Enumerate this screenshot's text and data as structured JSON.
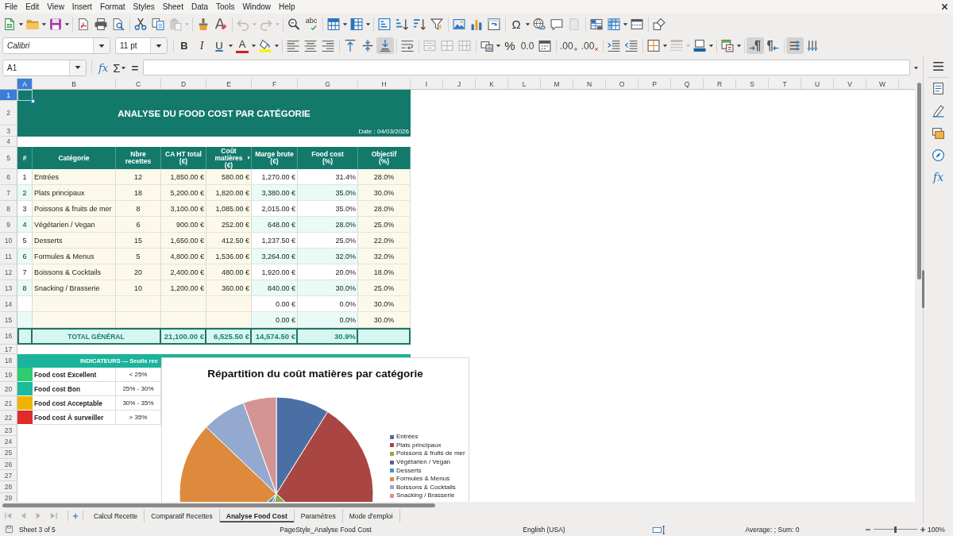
{
  "menu_bar": {
    "items": [
      "File",
      "Edit",
      "View",
      "Insert",
      "Format",
      "Styles",
      "Sheet",
      "Data",
      "Tools",
      "Window",
      "Help"
    ]
  },
  "standard_toolbar": {
    "spelling": "abc",
    "special_character": "Ω",
    "paste_disabled": true,
    "undo_disabled": true,
    "redo_disabled": true,
    "header_footer_disabled": true
  },
  "formatting_toolbar": {
    "font_name": "Calibri",
    "font_size": "11 pt",
    "bold": "B",
    "italic": "I",
    "underline": "U",
    "font_color": "A",
    "percent": "%",
    "standard_format": "0.0",
    "add_decimal": ".00",
    "delete_decimal": ".00",
    "align_bottom_on": true,
    "merge_disabled": true,
    "border_style_disabled": true,
    "left_to_right_on": true,
    "text_left_to_right_on": true
  },
  "formula_bar": {
    "name_box": "A1",
    "function_wizard": "fx",
    "sum": "Σ",
    "equals": "="
  },
  "sheet": {
    "columns": [
      {
        "label": "A",
        "selected": true
      },
      {
        "label": "B",
        "selected": false
      },
      {
        "label": "C",
        "selected": false
      },
      {
        "label": "D",
        "selected": false
      },
      {
        "label": "E",
        "selected": false
      },
      {
        "label": "F",
        "selected": false
      },
      {
        "label": "G",
        "selected": false
      },
      {
        "label": "H",
        "selected": false
      },
      {
        "label": "I",
        "selected": false
      },
      {
        "label": "J",
        "selected": false
      },
      {
        "label": "K",
        "selected": false
      },
      {
        "label": "L",
        "selected": false
      },
      {
        "label": "M",
        "selected": false
      },
      {
        "label": "N",
        "selected": false
      },
      {
        "label": "O",
        "selected": false
      },
      {
        "label": "P",
        "selected": false
      },
      {
        "label": "Q",
        "selected": false
      },
      {
        "label": "R",
        "selected": false
      },
      {
        "label": "S",
        "selected": false
      },
      {
        "label": "T",
        "selected": false
      },
      {
        "label": "U",
        "selected": false
      },
      {
        "label": "V",
        "selected": false
      },
      {
        "label": "W",
        "selected": false
      }
    ],
    "rows": [
      {
        "label": "1",
        "selected": true
      },
      {
        "label": "2",
        "selected": false
      },
      {
        "label": "3",
        "selected": false
      },
      {
        "label": "4",
        "selected": false
      },
      {
        "label": "5",
        "selected": false
      },
      {
        "label": "6",
        "selected": false
      },
      {
        "label": "7",
        "selected": false
      },
      {
        "label": "8",
        "selected": false
      },
      {
        "label": "9",
        "selected": false
      },
      {
        "label": "10",
        "selected": false
      },
      {
        "label": "11",
        "selected": false
      },
      {
        "label": "12",
        "selected": false
      },
      {
        "label": "13",
        "selected": false
      },
      {
        "label": "14",
        "selected": false
      },
      {
        "label": "15",
        "selected": false
      },
      {
        "label": "16",
        "selected": false
      },
      {
        "label": "17",
        "selected": false
      },
      {
        "label": "18",
        "selected": false
      },
      {
        "label": "19",
        "selected": false
      },
      {
        "label": "20",
        "selected": false
      },
      {
        "label": "21",
        "selected": false
      },
      {
        "label": "22",
        "selected": false
      },
      {
        "label": "23",
        "selected": false
      },
      {
        "label": "24",
        "selected": false
      },
      {
        "label": "25",
        "selected": false
      },
      {
        "label": "26",
        "selected": false
      },
      {
        "label": "27",
        "selected": false
      },
      {
        "label": "28",
        "selected": false
      },
      {
        "label": "29",
        "selected": false
      }
    ],
    "title": "ANALYSE DU FOOD COST PAR CATÉGORIE",
    "date": "Date : 04/03/2026",
    "table": {
      "columns": [
        {
          "label": "#"
        },
        {
          "label": "Catégorie"
        },
        {
          "label": "Nbre\nrecettes"
        },
        {
          "label": "CA HT total\n(€)"
        },
        {
          "label": "Coût\nmatières\n(€)",
          "overflow_marker": true
        },
        {
          "label": "Marge brute\n(€)"
        },
        {
          "label": "Food cost\n(%)"
        },
        {
          "label": "Objectif\n(%)"
        }
      ],
      "rows": [
        {
          "num": "1",
          "category": "Entrées",
          "recipes": "12",
          "revenue": "1,850.00 €",
          "cost": "580.00 €",
          "margin": "1,270.00 €",
          "food_cost": "31.4%",
          "target": "28.0%"
        },
        {
          "num": "2",
          "category": "Plats principaux",
          "recipes": "18",
          "revenue": "5,200.00 €",
          "cost": "1,820.00 €",
          "margin": "3,380.00 €",
          "food_cost": "35.0%",
          "target": "30.0%"
        },
        {
          "num": "3",
          "category": "Poissons & fruits de mer",
          "recipes": "8",
          "revenue": "3,100.00 €",
          "cost": "1,085.00 €",
          "margin": "2,015.00 €",
          "food_cost": "35.0%",
          "target": "28.0%"
        },
        {
          "num": "4",
          "category": "Végétarien / Vegan",
          "recipes": "6",
          "revenue": "900.00 €",
          "cost": "252.00 €",
          "margin": "648.00 €",
          "food_cost": "28.0%",
          "target": "25.0%"
        },
        {
          "num": "5",
          "category": "Desserts",
          "recipes": "15",
          "revenue": "1,650.00 €",
          "cost": "412.50 €",
          "margin": "1,237.50 €",
          "food_cost": "25.0%",
          "target": "22.0%"
        },
        {
          "num": "6",
          "category": "Formules & Menus",
          "recipes": "5",
          "revenue": "4,800.00 €",
          "cost": "1,536.00 €",
          "margin": "3,264.00 €",
          "food_cost": "32.0%",
          "target": "32.0%"
        },
        {
          "num": "7",
          "category": "Boissons & Cocktails",
          "recipes": "20",
          "revenue": "2,400.00 €",
          "cost": "480.00 €",
          "margin": "1,920.00 €",
          "food_cost": "20.0%",
          "target": "18.0%"
        },
        {
          "num": "8",
          "category": "Snacking / Brasserie",
          "recipes": "10",
          "revenue": "1,200.00 €",
          "cost": "360.00 €",
          "margin": "840.00 €",
          "food_cost": "30.0%",
          "target": "25.0%"
        },
        {
          "margin": "0.00 €",
          "food_cost": "0.0%",
          "target": "30.0%"
        },
        {
          "margin": "0.00 €",
          "food_cost": "0.0%",
          "target": "30.0%"
        }
      ],
      "total": {
        "label": "TOTAL GÉNÉRAL",
        "revenue": "21,100.00 €",
        "cost": "6,525.50 €",
        "margin": "14,574.50 €",
        "food_cost": "30.9%"
      }
    },
    "indicators": {
      "header": "INDICATEURS — Seuils rec",
      "rows": [
        {
          "color": "#2ecc71",
          "label": "Food cost Excellent",
          "range": "< 25%"
        },
        {
          "color": "#1abc9c",
          "label": "Food cost Bon",
          "range": "25% - 30%"
        },
        {
          "color": "#f0b400",
          "label": "Food cost Acceptable",
          "range": "30% - 35%"
        },
        {
          "color": "#e02b2b",
          "label": "Food cost À surveiller",
          "range": "> 35%"
        }
      ]
    },
    "chart": {
      "chart_data": {
        "type": "pie",
        "title": "Répartition du coût matières par catégorie",
        "categories": [
          "Entrées",
          "Plats principaux",
          "Poissons & fruits de mer",
          "Végétarien / Vegan",
          "Desserts",
          "Formules & Menus",
          "Boissons & Cocktails",
          "Snacking / Brasserie"
        ],
        "values": [
          8.89,
          27.89,
          16.63,
          3.86,
          6.32,
          23.53,
          7.36,
          5.52
        ],
        "legend": "right"
      }
    }
  },
  "sheet_tabs": [
    {
      "label": "Calcul Recette",
      "selected": false
    },
    {
      "label": "Comparatif Recettes",
      "selected": false
    },
    {
      "label": "Analyse Food Cost",
      "selected": true
    },
    {
      "label": "Paramètres",
      "selected": false
    },
    {
      "label": "Mode d'emploi",
      "selected": false
    }
  ],
  "status_bar": {
    "sheet": "Sheet 3 of 5",
    "page_style": "PageStyle_Analyse Food Cost",
    "language": "English (USA)",
    "selection_summary": "Average: ; Sum: 0",
    "zoom_slider": {
      "level": 0.5
    },
    "zoom": "100%"
  },
  "sidebar": {
    "functions": "fx"
  }
}
